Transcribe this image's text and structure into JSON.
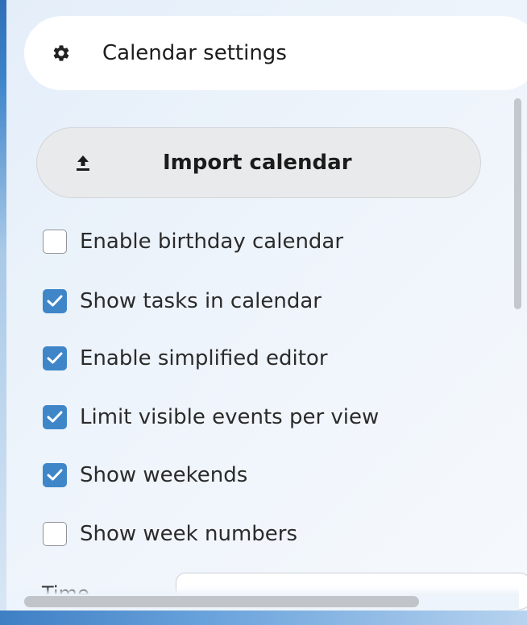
{
  "header": {
    "title": "Calendar settings",
    "icon": "gear-icon"
  },
  "import_button": {
    "label": "Import calendar",
    "icon": "upload-icon"
  },
  "options": [
    {
      "label": "Enable birthday calendar",
      "checked": false
    },
    {
      "label": "Show tasks in calendar",
      "checked": true
    },
    {
      "label": "Enable simplified editor",
      "checked": true
    },
    {
      "label": "Limit visible events per view",
      "checked": true
    },
    {
      "label": "Show weekends",
      "checked": true
    },
    {
      "label": "Show week numbers",
      "checked": false
    }
  ],
  "time": {
    "label": "Time",
    "value": ""
  },
  "colors": {
    "checkbox_checked": "#3f86c8",
    "panel_background": "#eef4fb",
    "button_background": "#e9eaeb"
  }
}
